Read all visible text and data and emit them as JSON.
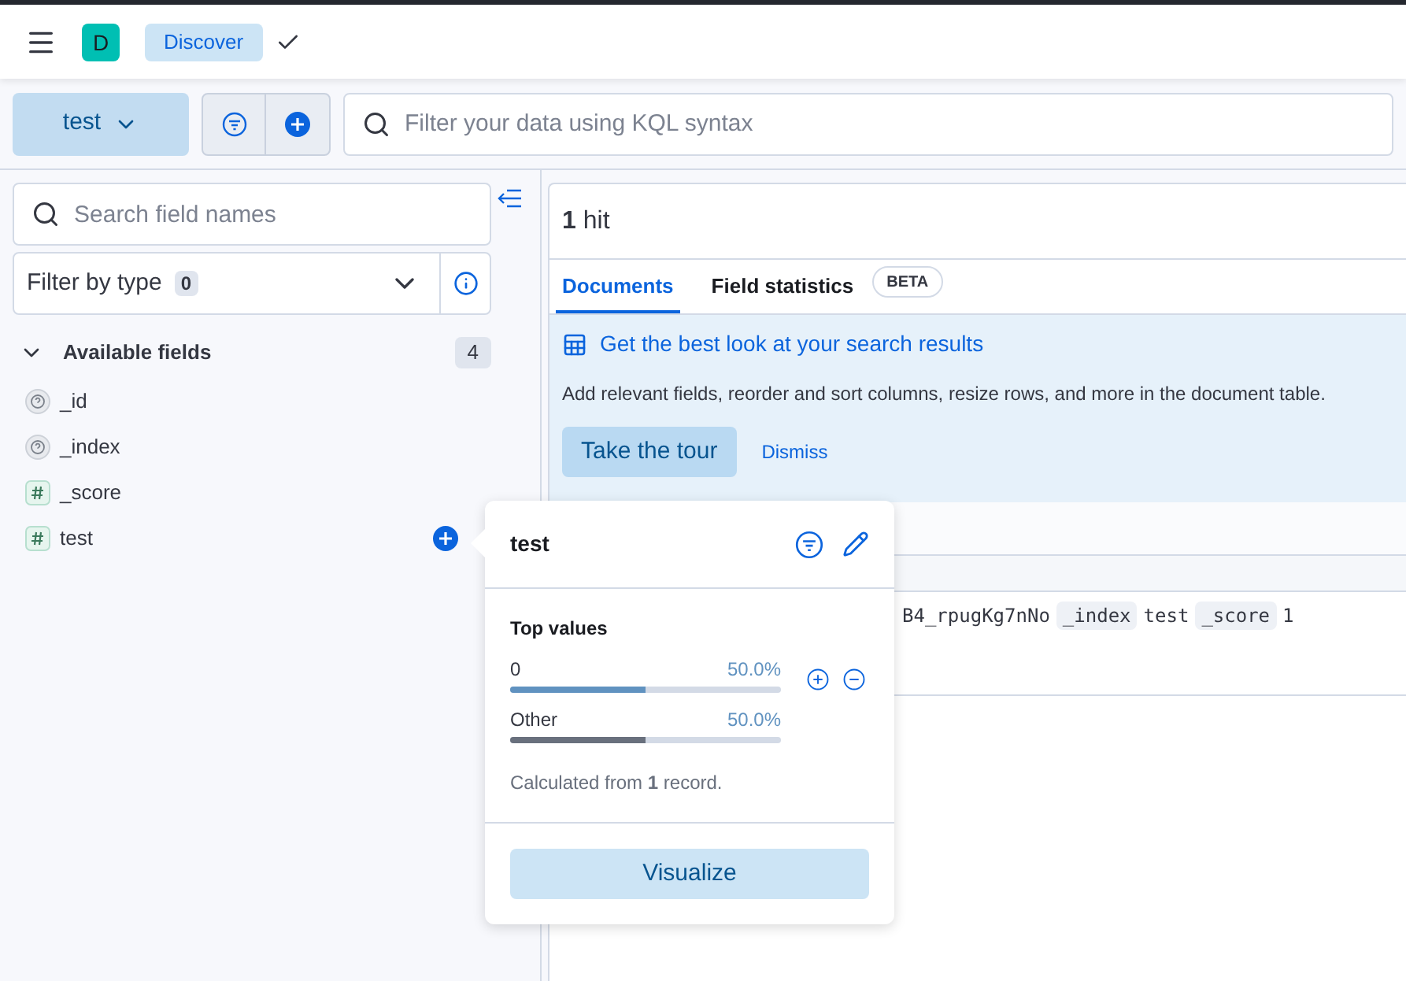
{
  "header": {
    "avatar": "D",
    "breadcrumb": "Discover"
  },
  "toolbar": {
    "data_view": "test",
    "query_placeholder": "Filter your data using KQL syntax"
  },
  "sidebar": {
    "search_placeholder": "Search field names",
    "filter_label": "Filter by type",
    "filter_count": "0",
    "section": {
      "title": "Available fields",
      "count": "4",
      "expanded": true
    },
    "fields": [
      {
        "name": "_id",
        "kind": "unknown",
        "selected": false
      },
      {
        "name": "_index",
        "kind": "unknown",
        "selected": false
      },
      {
        "name": "_score",
        "kind": "number",
        "selected": false
      },
      {
        "name": "test",
        "kind": "number",
        "selected": true
      }
    ]
  },
  "main": {
    "hits_count": "1",
    "hits_label": "hit",
    "tabs": [
      {
        "label": "Documents",
        "selected": true
      },
      {
        "label": "Field statistics",
        "selected": false,
        "badge": "BETA"
      }
    ],
    "callout": {
      "title": "Get the best look at your search results",
      "text": "Add relevant fields, reorder and sort columns, resize rows, and more in the document table.",
      "primary": "Take the tour",
      "secondary": "Dismiss"
    },
    "row": {
      "visible_text": "B4_rpugKg7nNo",
      "pairs": [
        {
          "key": "_index",
          "value": "test"
        },
        {
          "key": "_score",
          "value": "1"
        }
      ]
    }
  },
  "popover": {
    "title": "test",
    "section": "Top values",
    "values": [
      {
        "label": "0",
        "percent": "50.0%",
        "level": 0.5,
        "kind": "value"
      },
      {
        "label": "Other",
        "percent": "50.0%",
        "level": 0.5,
        "kind": "other"
      }
    ],
    "note": "Calculated from **1** record.",
    "button": "Visualize"
  }
}
